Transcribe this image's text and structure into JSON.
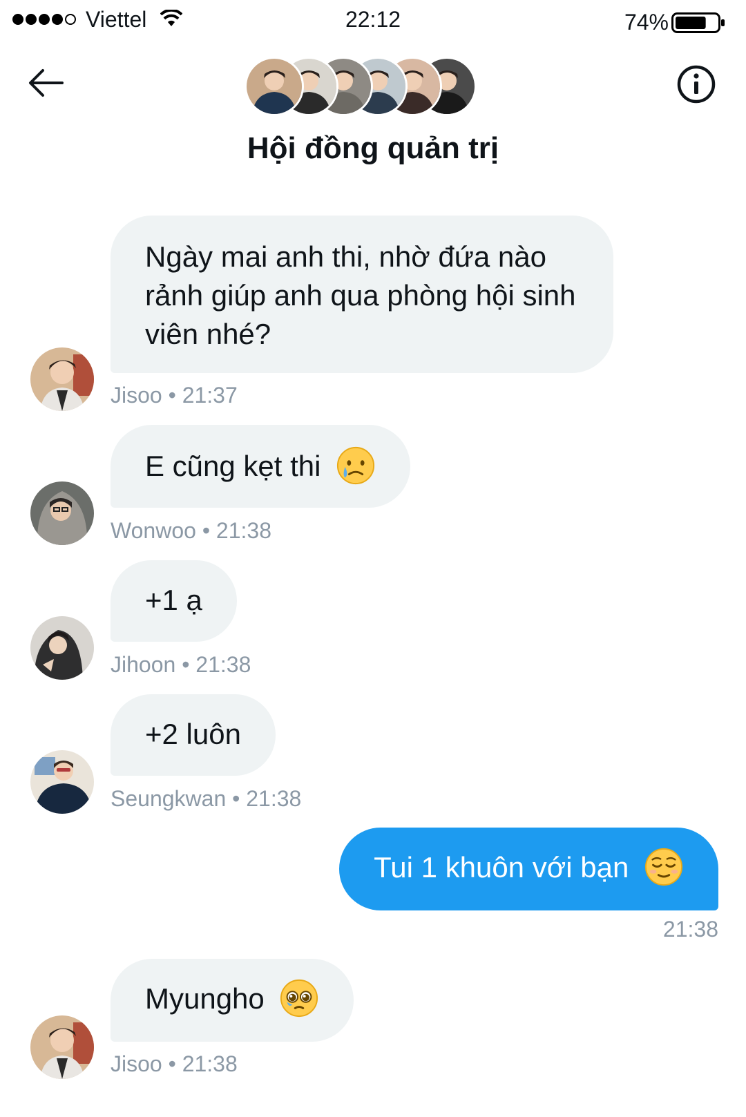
{
  "status_bar": {
    "carrier": "Viettel",
    "time": "22:12",
    "battery": "74%",
    "battery_level": 0.74
  },
  "header": {
    "title": "Hội đồng quản trị",
    "avatars": [
      {
        "name": "member-1",
        "bg": "#c9a98a",
        "shirt": "#1f3550"
      },
      {
        "name": "member-2",
        "bg": "#d9d6cf",
        "shirt": "#2a2a2a"
      },
      {
        "name": "member-3",
        "bg": "#8e8a84",
        "shirt": "#6d6a64"
      },
      {
        "name": "member-4",
        "bg": "#bfc9cf",
        "shirt": "#2c3c4e"
      },
      {
        "name": "member-5",
        "bg": "#d8b8a2",
        "shirt": "#3a2b28"
      },
      {
        "name": "member-6",
        "bg": "#4b4b4b",
        "shirt": "#1a1a1a"
      }
    ]
  },
  "messages": [
    {
      "text": "Ngày mai anh thi, nhờ đứa nào rảnh giúp anh qua phòng hội sinh viên nhé?",
      "sender": "Jisoo",
      "time": "21:37",
      "meta": "Jisoo • 21:37",
      "mine": false
    },
    {
      "text": "E cũng kẹt thi",
      "emoji": "crying-face",
      "sender": "Wonwoo",
      "time": "21:38",
      "meta": "Wonwoo • 21:38",
      "mine": false
    },
    {
      "text": "+1 ạ",
      "sender": "Jihoon",
      "time": "21:38",
      "meta": "Jihoon • 21:38",
      "mine": false
    },
    {
      "text": "+2 luôn",
      "sender": "Seungkwan",
      "time": "21:38",
      "meta": "Seungkwan • 21:38",
      "mine": false
    },
    {
      "text": "Tui 1 khuôn với bạn",
      "emoji": "relieved-face",
      "time": "21:38",
      "meta": "21:38",
      "mine": true
    },
    {
      "text": "Myungho",
      "emoji": "pleading-face",
      "sender": "Jisoo",
      "time": "21:38",
      "meta": "Jisoo • 21:38",
      "mine": false
    }
  ],
  "colors": {
    "accent": "#1d9bf0",
    "bubble_other": "#eff3f4",
    "meta_text": "#8b98a5"
  }
}
